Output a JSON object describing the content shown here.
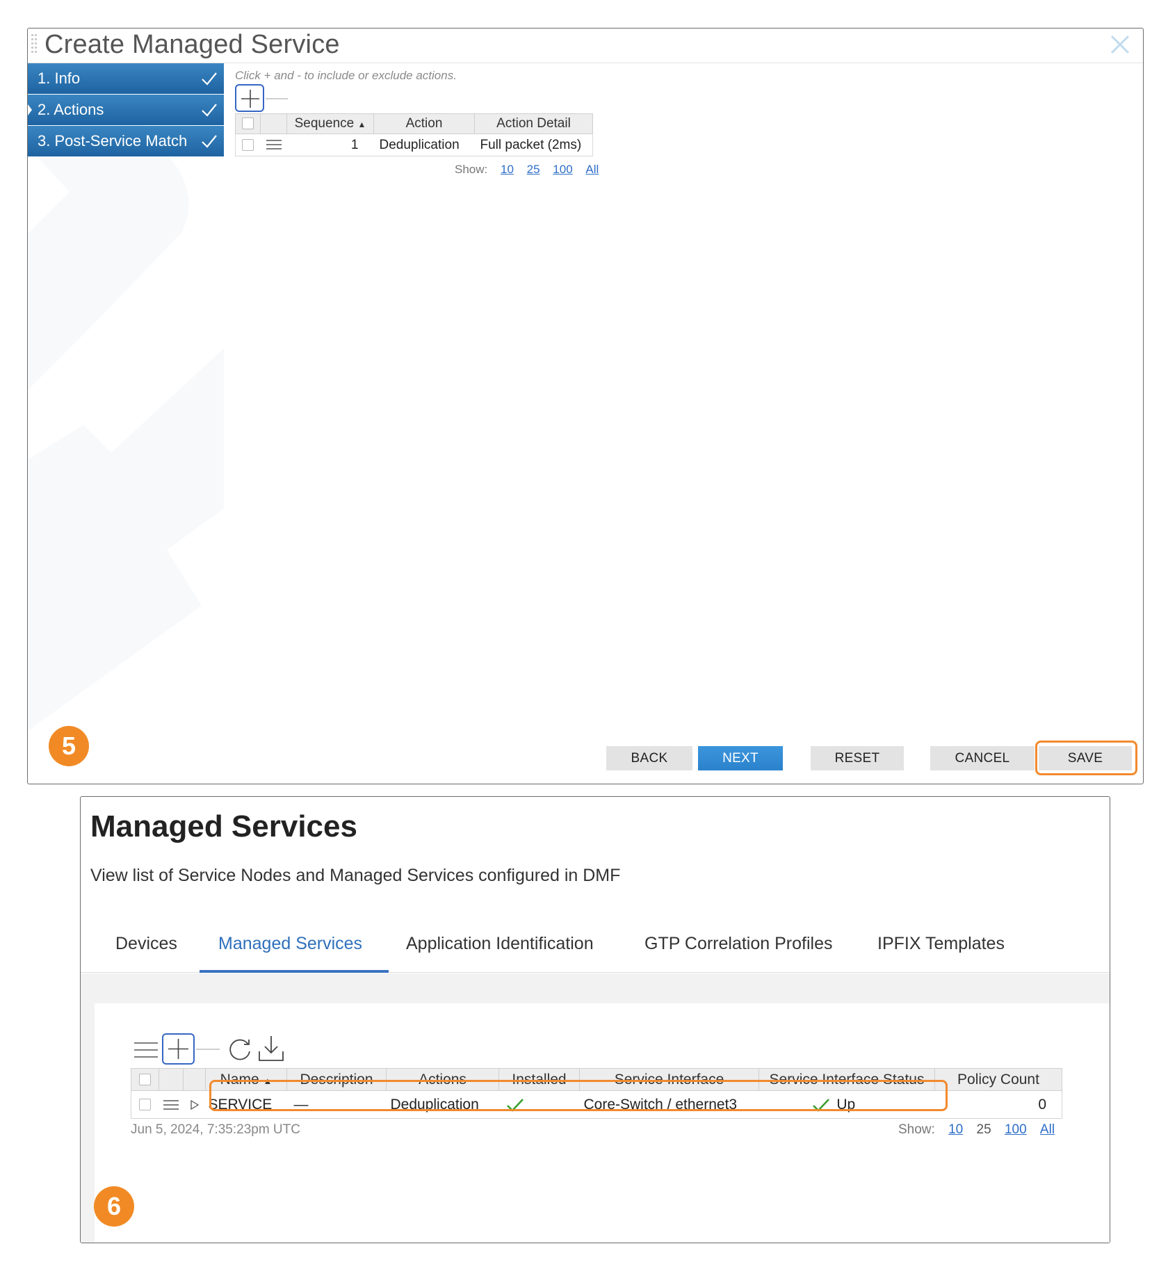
{
  "dialog": {
    "title": "Create Managed Service",
    "close_icon": "close-icon",
    "steps": [
      {
        "label": "1. Info"
      },
      {
        "label": "2. Actions"
      },
      {
        "label": "3. Post-Service Match"
      }
    ],
    "hint": "Click + and - to include or exclude actions.",
    "table": {
      "headers": [
        "Sequence",
        "Action",
        "Action Detail"
      ],
      "rows": [
        {
          "sequence": "1",
          "action": "Deduplication",
          "detail": "Full packet (2ms)"
        }
      ]
    },
    "pager": {
      "label": "Show:",
      "options": [
        "10",
        "25",
        "100",
        "All"
      ]
    },
    "buttons": {
      "back": "BACK",
      "next": "NEXT",
      "reset": "RESET",
      "cancel": "CANCEL",
      "save": "SAVE"
    },
    "badge": "5"
  },
  "page": {
    "title": "Managed Services",
    "subtitle": "View list of Service Nodes and Managed Services configured in DMF",
    "tabs": [
      "Devices",
      "Managed Services",
      "Application Identification",
      "GTP Correlation Profiles",
      "IPFIX Templates"
    ],
    "active_tab": "Managed Services",
    "table": {
      "headers": [
        "Name",
        "Description",
        "Actions",
        "Installed",
        "Service Interface",
        "Service Interface Status",
        "Policy Count"
      ],
      "rows": [
        {
          "name": "SERVICE",
          "description": "—",
          "actions": "Deduplication",
          "installed": "check",
          "service_interface": "Core-Switch / ethernet3",
          "status": "Up",
          "policy_count": "0"
        }
      ]
    },
    "timestamp": "Jun 5, 2024, 7:35:23pm UTC",
    "pager": {
      "label": "Show:",
      "options": [
        "10",
        "25",
        "100",
        "All"
      ]
    },
    "badge": "6"
  },
  "colors": {
    "accent": "#2f6fbb",
    "step_blue": "#2a72b1",
    "highlight": "#f28a2e",
    "badge": "#f18a25",
    "check_green": "#3aa02f"
  }
}
